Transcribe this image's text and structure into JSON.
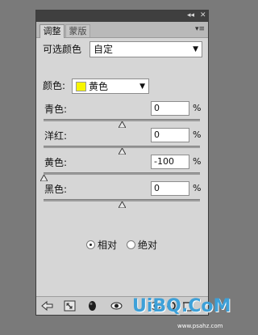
{
  "tabs": {
    "adjust": "调整",
    "mask": "蒙版"
  },
  "header": {
    "label": "可选颜色",
    "preset": "自定"
  },
  "colors": {
    "label": "颜色:",
    "selected": "黄色",
    "swatch": "#f7f600"
  },
  "sliders": [
    {
      "label": "青色:",
      "value": "0",
      "unit": "%",
      "level": 0
    },
    {
      "label": "洋红:",
      "value": "0",
      "unit": "%",
      "level": 0
    },
    {
      "label": "黄色:",
      "value": "-100",
      "unit": "%",
      "level": -100
    },
    {
      "label": "黑色:",
      "value": "0",
      "unit": "%",
      "level": 0
    }
  ],
  "method": {
    "relative": "相对",
    "absolute": "绝对",
    "selected": "relative"
  },
  "watermark": {
    "brand": "UiBQ.CoM",
    "site": "www.psahz.com"
  },
  "accent": "#3da0d8"
}
